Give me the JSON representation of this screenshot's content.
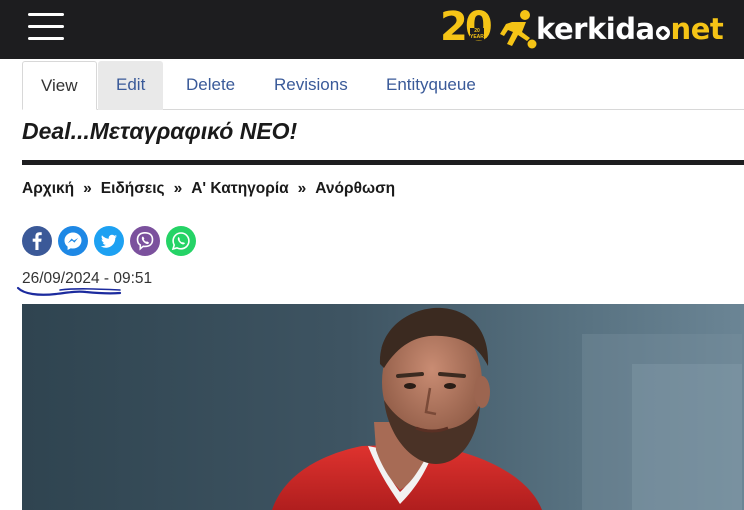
{
  "header": {
    "menu_icon": "hamburger-menu-icon",
    "logo": {
      "badge_number": "20",
      "badge_small": "20 YEARS",
      "brand_main": "kerkida",
      "brand_tld": "net",
      "brand_color": "#f5c416"
    },
    "background": "#1d1d1f"
  },
  "tabs": [
    {
      "label": "View",
      "active": true
    },
    {
      "label": "Edit",
      "active": false
    },
    {
      "label": "Delete",
      "active": false
    },
    {
      "label": "Revisions",
      "active": false
    },
    {
      "label": "Entityqueue",
      "active": false
    }
  ],
  "article": {
    "title": "Deal...Μεταγραφικό ΝΕΟ!",
    "breadcrumb": [
      "Αρχική",
      "Ειδήσεις",
      "Α' Κατηγορία",
      "Ανόρθωση"
    ],
    "breadcrumb_separator": "»",
    "share": [
      {
        "name": "facebook-icon",
        "color": "#3b5998"
      },
      {
        "name": "messenger-icon",
        "color": "#1e88e5"
      },
      {
        "name": "twitter-icon",
        "color": "#1da1f2"
      },
      {
        "name": "viber-icon",
        "color": "#7b519d"
      },
      {
        "name": "whatsapp-icon",
        "color": "#25d366"
      }
    ],
    "date": "26/09/2024 - 09:51"
  },
  "colors": {
    "tab_link": "#3a5a99",
    "annotation": "#1c2b9e"
  }
}
